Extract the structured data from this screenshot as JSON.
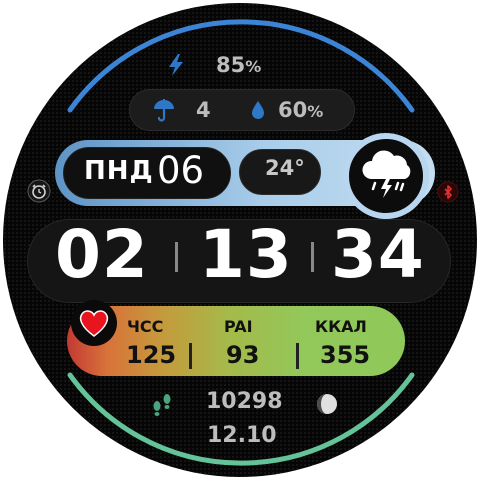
{
  "battery": {
    "value": "85",
    "unit": "%",
    "icon": "lightning-icon"
  },
  "weather": {
    "rain_chance": "4",
    "humidity": {
      "value": "60",
      "unit": "%"
    },
    "temperature": "24°",
    "condition_icon": "thunderstorm-cloud-icon"
  },
  "date": {
    "weekday": "ПНД",
    "day": "06",
    "full": "12.10"
  },
  "time": {
    "hours": "02",
    "minutes": "13",
    "seconds": "34"
  },
  "health": {
    "heart_rate": {
      "label": "ЧСС",
      "value": "125"
    },
    "pai": {
      "label": "PAI",
      "value": "93"
    },
    "calories": {
      "label": "ККАЛ",
      "value": "355"
    }
  },
  "steps": {
    "value": "10298"
  },
  "colors": {
    "accent_blue": "#3c85d6",
    "light_blue": "#b8d6ef",
    "health_green": "#8fc95a",
    "health_red": "#c23a33",
    "bluetooth_red": "#d62828"
  }
}
